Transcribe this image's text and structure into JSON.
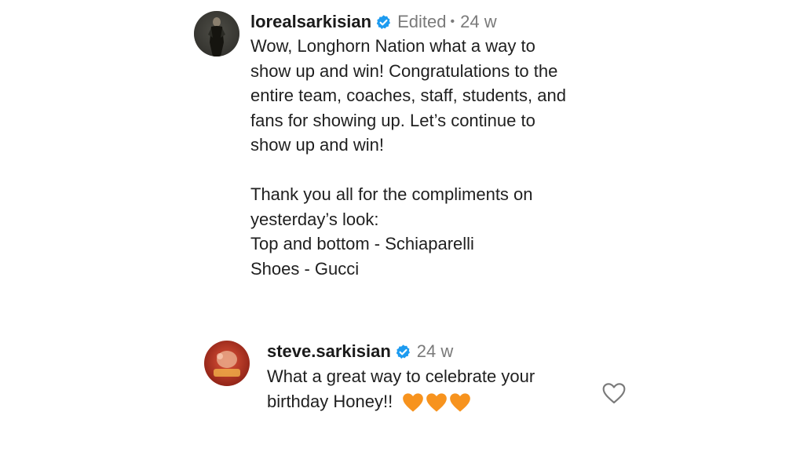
{
  "post": {
    "username": "lorealsarkisian",
    "edited_label": "Edited",
    "separator": "•",
    "time_ago": "24 w",
    "caption_lines": [
      "Wow, Longhorn Nation what a way to",
      "show up and win! Congratulations to the",
      "entire team, coaches, staff, students, and",
      "fans for showing up. Let’s continue to",
      "show up and win!",
      "",
      "Thank you all for the compliments on",
      "yesterday’s look:",
      "Top and bottom - Schiaparelli",
      "Shoes - Gucci"
    ]
  },
  "reply": {
    "username": "steve.sarkisian",
    "time_ago": "24 w",
    "text_line1": "What a great way to celebrate your",
    "text_line2": "birthday Honey!!",
    "hearts": [
      "orange-heart-icon",
      "orange-heart-icon",
      "orange-heart-icon"
    ],
    "like_icon": "heart-outline-icon"
  },
  "colors": {
    "verified_blue": "#1d9bf0",
    "meta_gray": "#7a7a7a",
    "heart_orange": "#f7931e"
  }
}
